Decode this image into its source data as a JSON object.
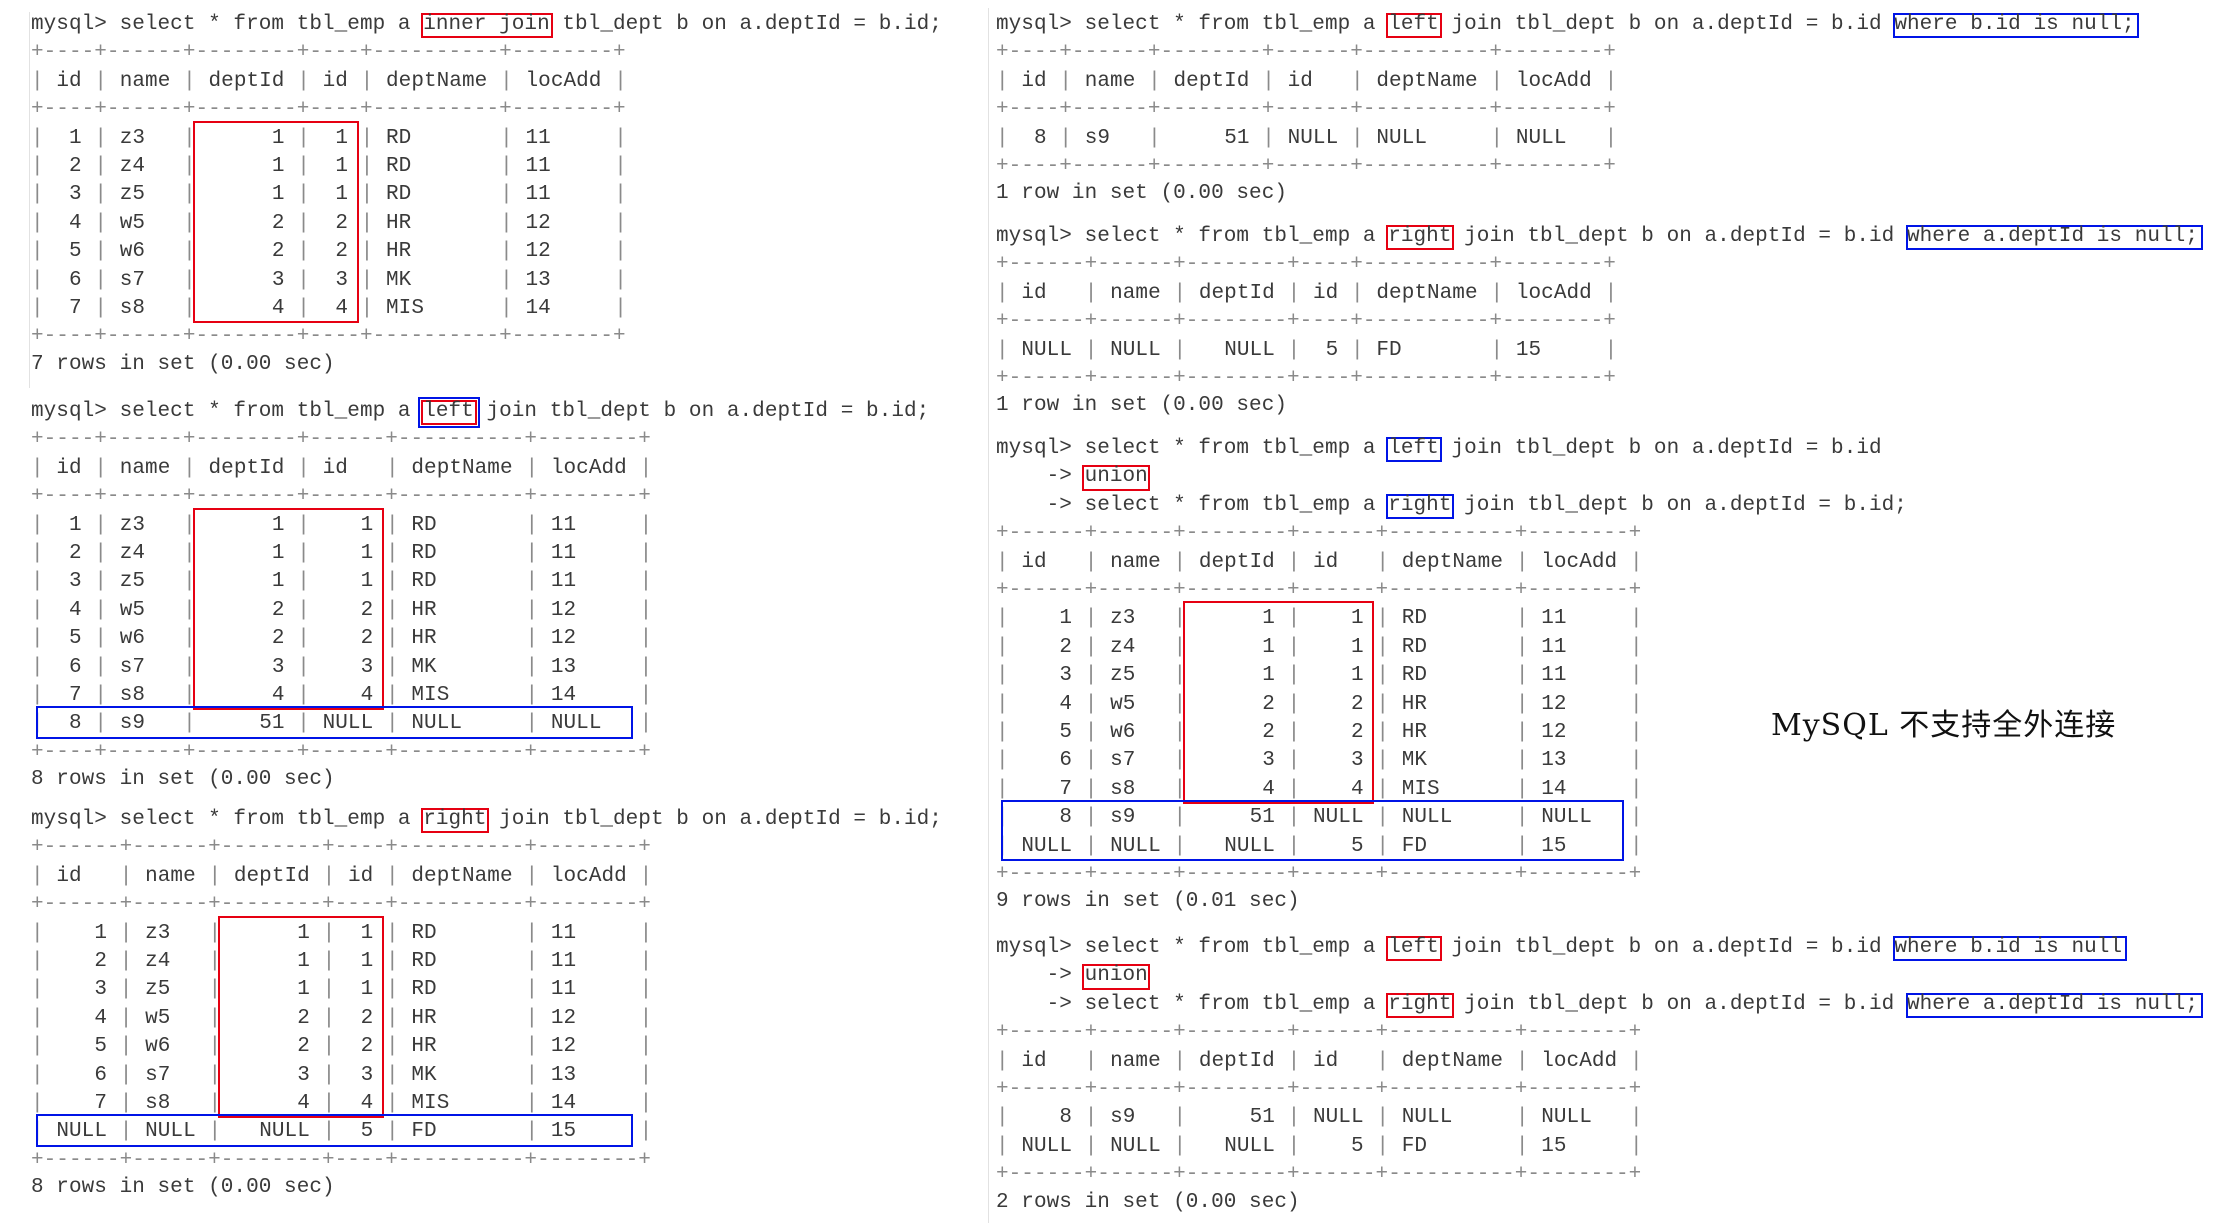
{
  "caption": "MySQL 不支持全外连接",
  "highlight_colors": {
    "red": "#e60012",
    "blue": "#0014e6"
  },
  "blocks": [
    {
      "id": "inner-join",
      "column": "left",
      "query_lines": [
        {
          "segments": [
            {
              "text": "mysql> select * from tbl_emp a "
            },
            {
              "text": "inner join",
              "box": "red"
            },
            {
              "text": " tbl_dept b on a.deptId = b.id;"
            }
          ]
        }
      ],
      "widths": [
        4,
        6,
        8,
        4,
        10,
        8
      ],
      "align": [
        "r",
        "l",
        "r",
        "r",
        "l",
        "l"
      ],
      "headers": [
        "id",
        "name",
        "deptId",
        "id",
        "deptName",
        "locAdd"
      ],
      "rows": [
        [
          "1",
          "z3",
          "1",
          "1",
          "RD",
          "11"
        ],
        [
          "2",
          "z4",
          "1",
          "1",
          "RD",
          "11"
        ],
        [
          "3",
          "z5",
          "1",
          "1",
          "RD",
          "11"
        ],
        [
          "4",
          "w5",
          "2",
          "2",
          "HR",
          "12"
        ],
        [
          "5",
          "w6",
          "2",
          "2",
          "HR",
          "12"
        ],
        [
          "6",
          "s7",
          "3",
          "3",
          "MK",
          "13"
        ],
        [
          "7",
          "s8",
          "4",
          "4",
          "MIS",
          "14"
        ]
      ],
      "footer": "7 rows in set (0.00 sec)",
      "row_boxes": [
        {
          "color": "red",
          "row_from": 0,
          "row_to": 6,
          "col_from": 2,
          "col_to": 3
        }
      ]
    },
    {
      "id": "left-join",
      "column": "left",
      "query_lines": [
        {
          "segments": [
            {
              "text": "mysql> select * from tbl_emp a "
            },
            {
              "text": "left",
              "box": "red",
              "outer_box": "blue"
            },
            {
              "text": " join tbl_dept b on a.deptId = b.id;"
            }
          ]
        }
      ],
      "widths": [
        4,
        6,
        8,
        6,
        10,
        8
      ],
      "align": [
        "r",
        "l",
        "r",
        "r",
        "l",
        "l"
      ],
      "headers": [
        "id",
        "name",
        "deptId",
        "id",
        "deptName",
        "locAdd"
      ],
      "rows": [
        [
          "1",
          "z3",
          "1",
          "1",
          "RD",
          "11"
        ],
        [
          "2",
          "z4",
          "1",
          "1",
          "RD",
          "11"
        ],
        [
          "3",
          "z5",
          "1",
          "1",
          "RD",
          "11"
        ],
        [
          "4",
          "w5",
          "2",
          "2",
          "HR",
          "12"
        ],
        [
          "5",
          "w6",
          "2",
          "2",
          "HR",
          "12"
        ],
        [
          "6",
          "s7",
          "3",
          "3",
          "MK",
          "13"
        ],
        [
          "7",
          "s8",
          "4",
          "4",
          "MIS",
          "14"
        ],
        [
          "8",
          "s9",
          "51",
          "NULL",
          "NULL",
          "NULL"
        ]
      ],
      "footer": "8 rows in set (0.00 sec)",
      "row_boxes": [
        {
          "color": "red",
          "row_from": 0,
          "row_to": 6,
          "col_from": 2,
          "col_to": 3
        },
        {
          "color": "blue",
          "row_from": 7,
          "row_to": 7,
          "col_from": 0,
          "col_to": 5
        }
      ]
    },
    {
      "id": "right-join",
      "column": "left",
      "query_lines": [
        {
          "segments": [
            {
              "text": "mysql> select * from tbl_emp a "
            },
            {
              "text": "right",
              "box": "red"
            },
            {
              "text": " join tbl_dept b on a.deptId = b.id;"
            }
          ]
        }
      ],
      "widths": [
        6,
        6,
        8,
        4,
        10,
        8
      ],
      "align": [
        "r",
        "l",
        "r",
        "r",
        "l",
        "l"
      ],
      "headers": [
        "id",
        "name",
        "deptId",
        "id",
        "deptName",
        "locAdd"
      ],
      "rows": [
        [
          "1",
          "z3",
          "1",
          "1",
          "RD",
          "11"
        ],
        [
          "2",
          "z4",
          "1",
          "1",
          "RD",
          "11"
        ],
        [
          "3",
          "z5",
          "1",
          "1",
          "RD",
          "11"
        ],
        [
          "4",
          "w5",
          "2",
          "2",
          "HR",
          "12"
        ],
        [
          "5",
          "w6",
          "2",
          "2",
          "HR",
          "12"
        ],
        [
          "6",
          "s7",
          "3",
          "3",
          "MK",
          "13"
        ],
        [
          "7",
          "s8",
          "4",
          "4",
          "MIS",
          "14"
        ],
        [
          "NULL",
          "NULL",
          "NULL",
          "5",
          "FD",
          "15"
        ]
      ],
      "footer": "8 rows in set (0.00 sec)",
      "row_boxes": [
        {
          "color": "red",
          "row_from": 0,
          "row_to": 6,
          "col_from": 2,
          "col_to": 3
        },
        {
          "color": "blue",
          "row_from": 7,
          "row_to": 7,
          "col_from": 0,
          "col_to": 5
        }
      ]
    },
    {
      "id": "left-join-exclusive",
      "column": "right",
      "query_lines": [
        {
          "segments": [
            {
              "text": "mysql> select * from tbl_emp a "
            },
            {
              "text": "left",
              "box": "red"
            },
            {
              "text": " join tbl_dept b on a.deptId = b.id "
            },
            {
              "text": "where b.id is null;",
              "box": "blue"
            }
          ]
        }
      ],
      "widths": [
        4,
        6,
        8,
        6,
        10,
        8
      ],
      "align": [
        "r",
        "l",
        "r",
        "r",
        "l",
        "l"
      ],
      "headers": [
        "id",
        "name",
        "deptId",
        "id",
        "deptName",
        "locAdd"
      ],
      "rows": [
        [
          "8",
          "s9",
          "51",
          "NULL",
          "NULL",
          "NULL"
        ]
      ],
      "footer": "1 row in set (0.00 sec)",
      "row_boxes": []
    },
    {
      "id": "right-join-exclusive",
      "column": "right",
      "query_lines": [
        {
          "segments": [
            {
              "text": "mysql> select * from tbl_emp a "
            },
            {
              "text": "right",
              "box": "red"
            },
            {
              "text": " join tbl_dept b on a.deptId = b.id "
            },
            {
              "text": "where a.deptId is null;",
              "box": "blue"
            }
          ]
        }
      ],
      "widths": [
        6,
        6,
        8,
        4,
        10,
        8
      ],
      "align": [
        "r",
        "l",
        "r",
        "r",
        "l",
        "l"
      ],
      "headers": [
        "id",
        "name",
        "deptId",
        "id",
        "deptName",
        "locAdd"
      ],
      "rows": [
        [
          "NULL",
          "NULL",
          "NULL",
          "5",
          "FD",
          "15"
        ]
      ],
      "footer": "1 row in set (0.00 sec)",
      "row_boxes": []
    },
    {
      "id": "full-outer-union",
      "column": "right",
      "query_lines": [
        {
          "segments": [
            {
              "text": "mysql> select * from tbl_emp a "
            },
            {
              "text": "left",
              "box": "blue"
            },
            {
              "text": " join tbl_dept b on a.deptId = b.id"
            }
          ]
        },
        {
          "segments": [
            {
              "text": "    -> "
            },
            {
              "text": "union",
              "box": "red"
            }
          ]
        },
        {
          "segments": [
            {
              "text": "    -> select * from tbl_emp a "
            },
            {
              "text": "right",
              "box": "blue"
            },
            {
              "text": " join tbl_dept b on a.deptId = b.id;"
            }
          ]
        }
      ],
      "widths": [
        6,
        6,
        8,
        6,
        10,
        8
      ],
      "align": [
        "r",
        "l",
        "r",
        "r",
        "l",
        "l"
      ],
      "headers": [
        "id",
        "name",
        "deptId",
        "id",
        "deptName",
        "locAdd"
      ],
      "rows": [
        [
          "1",
          "z3",
          "1",
          "1",
          "RD",
          "11"
        ],
        [
          "2",
          "z4",
          "1",
          "1",
          "RD",
          "11"
        ],
        [
          "3",
          "z5",
          "1",
          "1",
          "RD",
          "11"
        ],
        [
          "4",
          "w5",
          "2",
          "2",
          "HR",
          "12"
        ],
        [
          "5",
          "w6",
          "2",
          "2",
          "HR",
          "12"
        ],
        [
          "6",
          "s7",
          "3",
          "3",
          "MK",
          "13"
        ],
        [
          "7",
          "s8",
          "4",
          "4",
          "MIS",
          "14"
        ],
        [
          "8",
          "s9",
          "51",
          "NULL",
          "NULL",
          "NULL"
        ],
        [
          "NULL",
          "NULL",
          "NULL",
          "5",
          "FD",
          "15"
        ]
      ],
      "footer": "9 rows in set (0.01 sec)",
      "row_boxes": [
        {
          "color": "red",
          "row_from": 0,
          "row_to": 6,
          "col_from": 2,
          "col_to": 3
        },
        {
          "color": "blue",
          "row_from": 7,
          "row_to": 8,
          "col_from": 0,
          "col_to": 5
        }
      ]
    },
    {
      "id": "exclusive-union",
      "column": "right",
      "query_lines": [
        {
          "segments": [
            {
              "text": "mysql> select * from tbl_emp a "
            },
            {
              "text": "left",
              "box": "red"
            },
            {
              "text": " join tbl_dept b on a.deptId = b.id "
            },
            {
              "text": "where b.id is null",
              "box": "blue"
            }
          ]
        },
        {
          "segments": [
            {
              "text": "    -> "
            },
            {
              "text": "union",
              "box": "red"
            }
          ]
        },
        {
          "segments": [
            {
              "text": "    -> select * from tbl_emp a "
            },
            {
              "text": "right",
              "box": "red"
            },
            {
              "text": " join tbl_dept b on a.deptId = b.id "
            },
            {
              "text": "where a.deptId is null;",
              "box": "blue"
            }
          ]
        }
      ],
      "widths": [
        6,
        6,
        8,
        6,
        10,
        8
      ],
      "align": [
        "r",
        "l",
        "r",
        "r",
        "l",
        "l"
      ],
      "headers": [
        "id",
        "name",
        "deptId",
        "id",
        "deptName",
        "locAdd"
      ],
      "rows": [
        [
          "8",
          "s9",
          "51",
          "NULL",
          "NULL",
          "NULL"
        ],
        [
          "NULL",
          "NULL",
          "NULL",
          "5",
          "FD",
          "15"
        ]
      ],
      "footer": "2 rows in set (0.00 sec)",
      "row_boxes": []
    }
  ]
}
